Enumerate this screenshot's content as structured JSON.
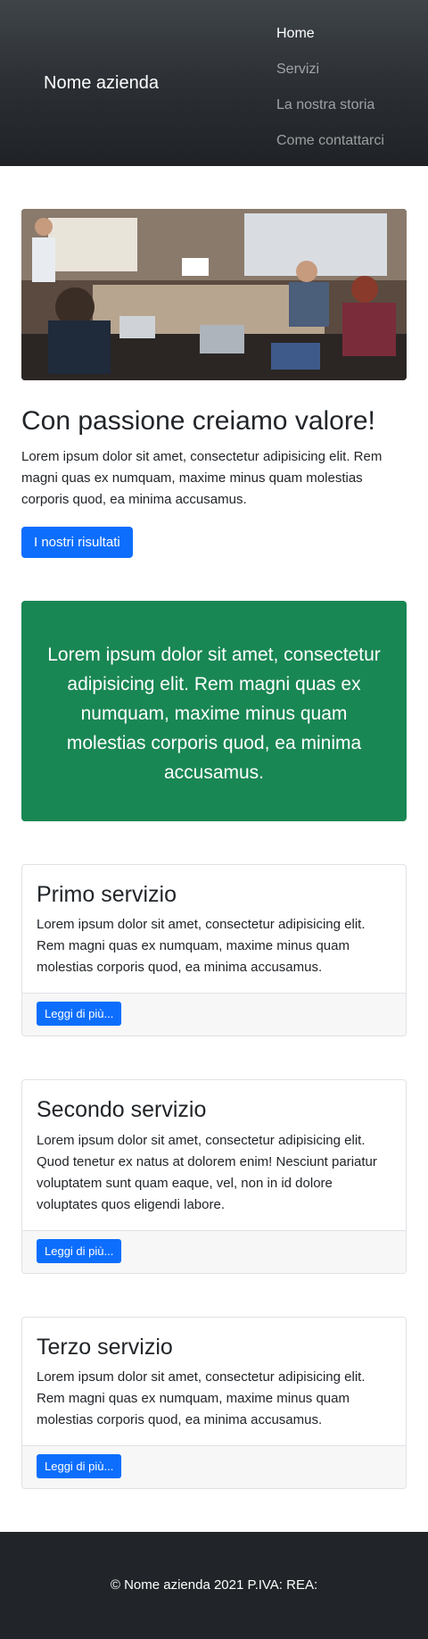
{
  "navbar": {
    "brand": "Nome azienda",
    "items": [
      {
        "label": "Home"
      },
      {
        "label": "Servizi"
      },
      {
        "label": "La nostra storia"
      },
      {
        "label": "Come contattarci"
      }
    ]
  },
  "hero": {
    "title": "Con passione creiamo valore!",
    "text": "Lorem ipsum dolor sit amet, consectetur adipisicing elit. Rem magni quas ex numquam, maxime minus quam molestias corporis quod, ea minima accusamus.",
    "button": "I nostri risultati"
  },
  "highlight": {
    "text": "Lorem ipsum dolor sit amet, consectetur adipisicing elit. Rem magni quas ex numquam, maxime minus quam molestias corporis quod, ea minima accusamus."
  },
  "services": [
    {
      "title": "Primo servizio",
      "text": "Lorem ipsum dolor sit amet, consectetur adipisicing elit. Rem magni quas ex numquam, maxime minus quam molestias corporis quod, ea minima accusamus.",
      "button": "Leggi di più..."
    },
    {
      "title": "Secondo servizio",
      "text": "Lorem ipsum dolor sit amet, consectetur adipisicing elit. Quod tenetur ex natus at dolorem enim! Nesciunt pariatur voluptatem sunt quam eaque, vel, non in id dolore voluptates quos eligendi labore.",
      "button": "Leggi di più..."
    },
    {
      "title": "Terzo servizio",
      "text": "Lorem ipsum dolor sit amet, consectetur adipisicing elit. Rem magni quas ex numquam, maxime minus quam molestias corporis quod, ea minima accusamus.",
      "button": "Leggi di più..."
    }
  ],
  "footer": {
    "text": "© Nome azienda 2021 P.IVA: REA:"
  },
  "colors": {
    "primary": "#0d6efd",
    "success": "#198754",
    "dark": "#212529"
  }
}
